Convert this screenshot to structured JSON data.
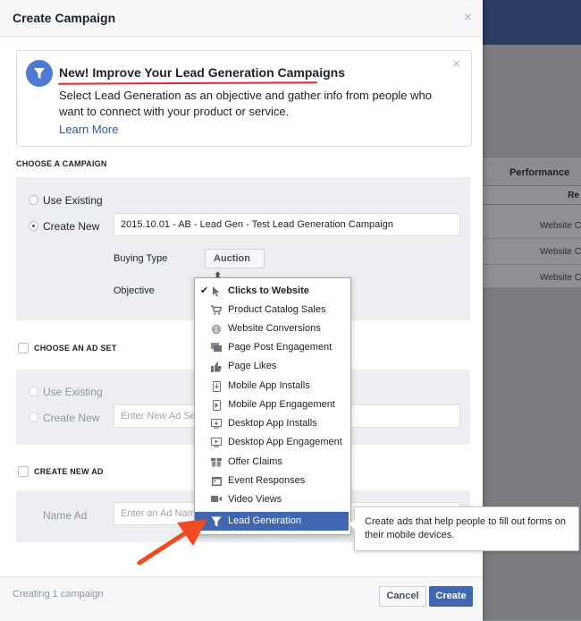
{
  "background": {
    "performance_header": "Performance",
    "sub_header": "Re",
    "cells": [
      "Website C",
      "Website C",
      "Website C"
    ]
  },
  "modal": {
    "title": "Create Campaign",
    "close_glyph": "×"
  },
  "promo": {
    "title": "New! Improve Your Lead Generation Campaigns",
    "body": "Select Lead Generation as an objective and gather info from people who want to connect with your product or service.",
    "link": "Learn More",
    "close_glyph": "×"
  },
  "campaign": {
    "section_label": "CHOOSE A CAMPAIGN",
    "use_existing": "Use Existing",
    "create_new": "Create New",
    "name_value": "2015.10.01 - AB - Lead Gen - Test Lead Generation Campaign",
    "buying_type_label": "Buying Type",
    "buying_type_value": "Auction ⬍",
    "objective_label": "Objective"
  },
  "ad_set": {
    "section_label": "CHOOSE AN AD SET",
    "use_existing": "Use Existing",
    "create_new": "Create New",
    "name_placeholder": "Enter New Ad Se"
  },
  "ad": {
    "section_label": "CREATE NEW AD",
    "name_label": "Name Ad",
    "name_placeholder": "Enter an Ad Nam"
  },
  "objective_menu": {
    "items": [
      {
        "label": "Clicks to Website",
        "icon": "cursor-icon",
        "selected": true
      },
      {
        "label": "Product Catalog Sales",
        "icon": "cart-icon"
      },
      {
        "label": "Website Conversions",
        "icon": "globe-icon"
      },
      {
        "label": "Page Post Engagement",
        "icon": "post-icon"
      },
      {
        "label": "Page Likes",
        "icon": "thumbs-up-icon"
      },
      {
        "label": "Mobile App Installs",
        "icon": "mobile-install-icon"
      },
      {
        "label": "Mobile App Engagement",
        "icon": "mobile-engage-icon"
      },
      {
        "label": "Desktop App Installs",
        "icon": "desktop-install-icon"
      },
      {
        "label": "Desktop App Engagement",
        "icon": "desktop-engage-icon"
      },
      {
        "label": "Offer Claims",
        "icon": "offer-icon"
      },
      {
        "label": "Event Responses",
        "icon": "calendar-icon"
      },
      {
        "label": "Video Views",
        "icon": "video-icon"
      },
      {
        "label": "Lead Generation",
        "icon": "funnel-icon",
        "highlighted": true
      }
    ],
    "check_glyph": "✔"
  },
  "tooltip": {
    "text": "Create ads that help people to fill out forms on their mobile devices."
  },
  "footer": {
    "status": "Creating 1 campaign",
    "cancel_label": "Cancel",
    "create_label": "Create"
  },
  "colors": {
    "accent": "#4267b2",
    "link": "#365899",
    "annotation_red": "#e12b2b",
    "arrow_red": "#f04a22"
  }
}
